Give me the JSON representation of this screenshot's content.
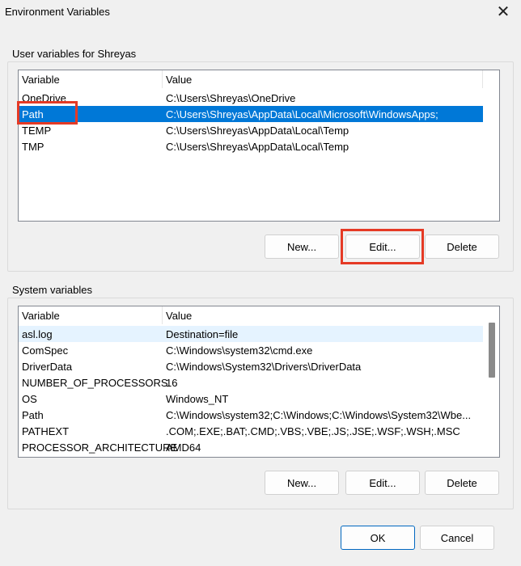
{
  "window": {
    "title": "Environment Variables",
    "close_glyph": "✕"
  },
  "user_section": {
    "label": "User variables for Shreyas",
    "columns": [
      "Variable",
      "Value"
    ],
    "rows": [
      {
        "variable": "OneDrive",
        "value": "C:\\Users\\Shreyas\\OneDrive"
      },
      {
        "variable": "Path",
        "value": "C:\\Users\\Shreyas\\AppData\\Local\\Microsoft\\WindowsApps;"
      },
      {
        "variable": "TEMP",
        "value": "C:\\Users\\Shreyas\\AppData\\Local\\Temp"
      },
      {
        "variable": "TMP",
        "value": "C:\\Users\\Shreyas\\AppData\\Local\\Temp"
      }
    ],
    "buttons": {
      "new": "New...",
      "edit": "Edit...",
      "delete": "Delete"
    }
  },
  "system_section": {
    "label": "System variables",
    "columns": [
      "Variable",
      "Value"
    ],
    "rows": [
      {
        "variable": "asl.log",
        "value": "Destination=file"
      },
      {
        "variable": "ComSpec",
        "value": "C:\\Windows\\system32\\cmd.exe"
      },
      {
        "variable": "DriverData",
        "value": "C:\\Windows\\System32\\Drivers\\DriverData"
      },
      {
        "variable": "NUMBER_OF_PROCESSORS",
        "value": "16"
      },
      {
        "variable": "OS",
        "value": "Windows_NT"
      },
      {
        "variable": "Path",
        "value": "C:\\Windows\\system32;C:\\Windows;C:\\Windows\\System32\\Wbe..."
      },
      {
        "variable": "PATHEXT",
        "value": ".COM;.EXE;.BAT;.CMD;.VBS;.VBE;.JS;.JSE;.WSF;.WSH;.MSC"
      },
      {
        "variable": "PROCESSOR_ARCHITECTURE",
        "value": "AMD64"
      }
    ],
    "buttons": {
      "new": "New...",
      "edit": "Edit...",
      "delete": "Delete"
    }
  },
  "footer": {
    "ok": "OK",
    "cancel": "Cancel"
  },
  "colors": {
    "selection": "#0078d7",
    "annotation": "#e53a25",
    "ok_border": "#0067c0"
  }
}
